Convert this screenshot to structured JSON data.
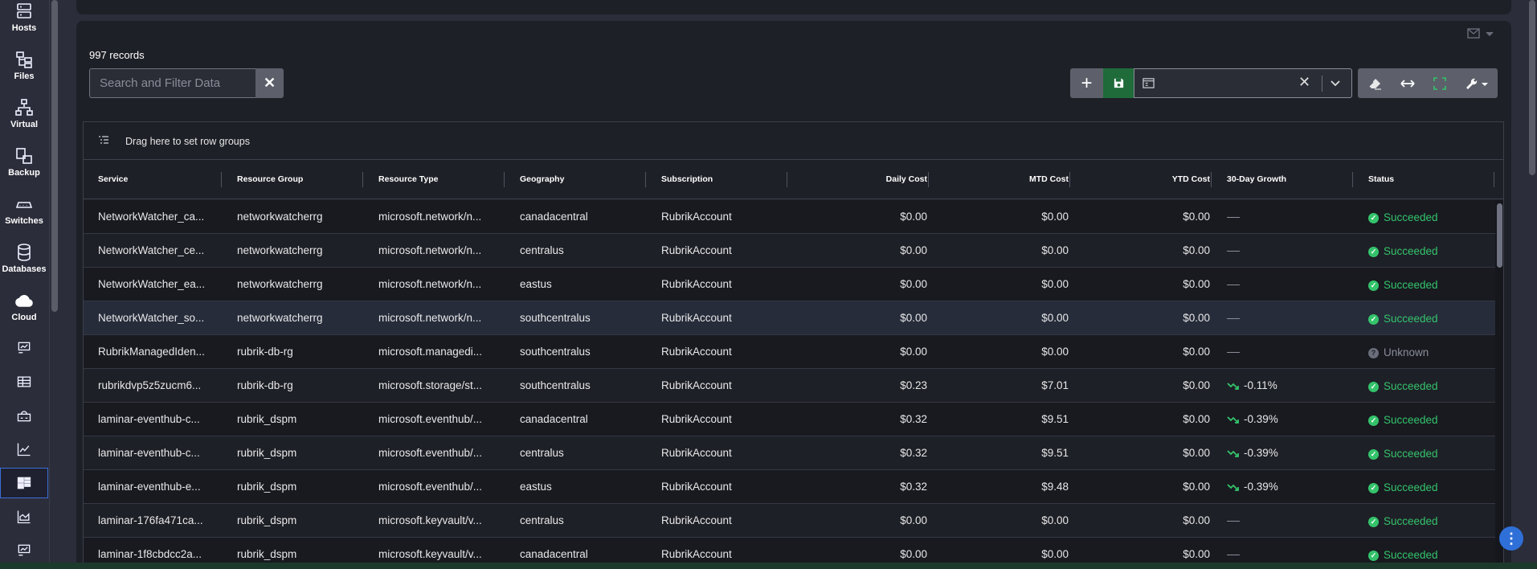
{
  "nav": {
    "items": [
      {
        "label": "Hosts",
        "icon": "server-icon"
      },
      {
        "label": "Files",
        "icon": "folder-tree-icon"
      },
      {
        "label": "Virtual",
        "icon": "network-icon"
      },
      {
        "label": "Backup",
        "icon": "backup-icon"
      },
      {
        "label": "Switches",
        "icon": "switch-icon"
      },
      {
        "label": "Databases",
        "icon": "database-icon"
      },
      {
        "label": "Cloud",
        "icon": "cloud-icon"
      }
    ],
    "icons": [
      "report-icon",
      "table-icon",
      "dashboard-icon",
      "line-chart-icon",
      "grid-list-icon",
      "area-chart-icon",
      "report-2-icon"
    ]
  },
  "toolbar": {
    "records": "997 records",
    "search_placeholder": "Search and Filter Data",
    "clear_label": "✕",
    "plus_label": "+",
    "select_clear": "✕"
  },
  "grid": {
    "group_bar_text": "Drag here to set row groups",
    "columns": [
      "Service",
      "Resource Group",
      "Resource Type",
      "Geography",
      "Subscription",
      "Daily Cost",
      "MTD Cost",
      "YTD Cost",
      "30-Day Growth",
      "Status"
    ],
    "rows": [
      {
        "service": "NetworkWatcher_ca...",
        "group": "networkwatcherrg",
        "type": "microsoft.network/n...",
        "geo": "canadacentral",
        "sub": "RubrikAccount",
        "daily": "$0.00",
        "mtd": "$0.00",
        "ytd": "$0.00",
        "growth": "",
        "status": "Succeeded"
      },
      {
        "service": "NetworkWatcher_ce...",
        "group": "networkwatcherrg",
        "type": "microsoft.network/n...",
        "geo": "centralus",
        "sub": "RubrikAccount",
        "daily": "$0.00",
        "mtd": "$0.00",
        "ytd": "$0.00",
        "growth": "",
        "status": "Succeeded"
      },
      {
        "service": "NetworkWatcher_ea...",
        "group": "networkwatcherrg",
        "type": "microsoft.network/n...",
        "geo": "eastus",
        "sub": "RubrikAccount",
        "daily": "$0.00",
        "mtd": "$0.00",
        "ytd": "$0.00",
        "growth": "",
        "status": "Succeeded"
      },
      {
        "service": "NetworkWatcher_so...",
        "group": "networkwatcherrg",
        "type": "microsoft.network/n...",
        "geo": "southcentralus",
        "sub": "RubrikAccount",
        "daily": "$0.00",
        "mtd": "$0.00",
        "ytd": "$0.00",
        "growth": "",
        "status": "Succeeded"
      },
      {
        "service": "RubrikManagedIden...",
        "group": "rubrik-db-rg",
        "type": "microsoft.managedi...",
        "geo": "southcentralus",
        "sub": "RubrikAccount",
        "daily": "$0.00",
        "mtd": "$0.00",
        "ytd": "$0.00",
        "growth": "",
        "status": "Unknown"
      },
      {
        "service": "rubrikdvp5z5zucm6...",
        "group": "rubrik-db-rg",
        "type": "microsoft.storage/st...",
        "geo": "southcentralus",
        "sub": "RubrikAccount",
        "daily": "$0.23",
        "mtd": "$7.01",
        "ytd": "$0.00",
        "growth": "-0.11%",
        "status": "Succeeded"
      },
      {
        "service": "laminar-eventhub-c...",
        "group": "rubrik_dspm",
        "type": "microsoft.eventhub/...",
        "geo": "canadacentral",
        "sub": "RubrikAccount",
        "daily": "$0.32",
        "mtd": "$9.51",
        "ytd": "$0.00",
        "growth": "-0.39%",
        "status": "Succeeded"
      },
      {
        "service": "laminar-eventhub-c...",
        "group": "rubrik_dspm",
        "type": "microsoft.eventhub/...",
        "geo": "centralus",
        "sub": "RubrikAccount",
        "daily": "$0.32",
        "mtd": "$9.51",
        "ytd": "$0.00",
        "growth": "-0.39%",
        "status": "Succeeded"
      },
      {
        "service": "laminar-eventhub-e...",
        "group": "rubrik_dspm",
        "type": "microsoft.eventhub/...",
        "geo": "eastus",
        "sub": "RubrikAccount",
        "daily": "$0.32",
        "mtd": "$9.48",
        "ytd": "$0.00",
        "growth": "-0.39%",
        "status": "Succeeded"
      },
      {
        "service": "laminar-176fa471ca...",
        "group": "rubrik_dspm",
        "type": "microsoft.keyvault/v...",
        "geo": "centralus",
        "sub": "RubrikAccount",
        "daily": "$0.00",
        "mtd": "$0.00",
        "ytd": "$0.00",
        "growth": "",
        "status": "Succeeded"
      },
      {
        "service": "laminar-1f8cbdcc2a...",
        "group": "rubrik_dspm",
        "type": "microsoft.keyvault/v...",
        "geo": "canadacentral",
        "sub": "RubrikAccount",
        "daily": "$0.00",
        "mtd": "$0.00",
        "ytd": "$0.00",
        "growth": "",
        "status": "Succeeded"
      }
    ]
  },
  "colors": {
    "accent": "#2f6fd8",
    "success": "#34c36b",
    "save": "#1f6b3a"
  },
  "fab_label": "⋮"
}
